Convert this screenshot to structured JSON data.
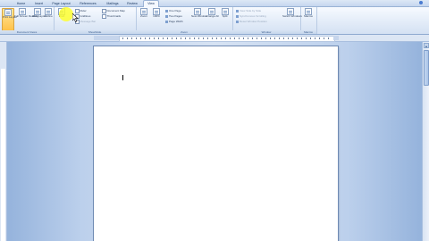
{
  "tabs": [
    "Home",
    "Insert",
    "Page Layout",
    "References",
    "Mailings",
    "Review",
    "View"
  ],
  "active_tab": "View",
  "ribbon": {
    "document_views": {
      "label": "Document Views",
      "print_layout": "Print Layout",
      "full_screen_reading": "Full Screen Reading",
      "web_layout": "Web Layout",
      "outline": "Outline",
      "draft": "Draft"
    },
    "show_hide": {
      "label": "Show/Hide",
      "ruler": "Ruler",
      "gridlines": "Gridlines",
      "message_bar": "Message Bar",
      "document_map": "Document Map",
      "thumbnails": "Thumbnails"
    },
    "zoom": {
      "label": "Zoom",
      "zoom": "Zoom",
      "hundred": "100%",
      "one_page": "One Page",
      "two_pages": "Two Pages",
      "page_width": "Page Width"
    },
    "window": {
      "label": "Window",
      "new_window": "New Window",
      "arrange_all": "Arrange All",
      "split": "Split",
      "view_side_by_side": "View Side by Side",
      "synchronous_scrolling": "Synchronous Scrolling",
      "reset_window_position": "Reset Window Position",
      "switch_windows": "Switch Windows"
    },
    "macros": {
      "label": "Macros",
      "macros": "Macros"
    }
  },
  "colors": {
    "ribbon_bg": "#e3ecf8",
    "active_button": "#ffc24a",
    "workspace": "#bcd0ec",
    "highlight": "#ffff28"
  }
}
